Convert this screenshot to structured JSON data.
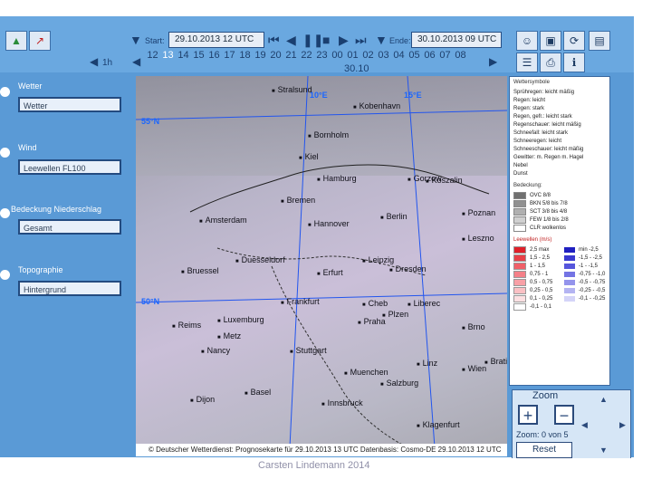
{
  "toolbar": {
    "start_label": "Start:",
    "start_value": "29.10.2013 12 UTC",
    "end_label": "Ende:",
    "end_value": "30.10.2013 09 UTC",
    "step_value": "1h",
    "hours": [
      "12",
      "13",
      "14",
      "15",
      "16",
      "17",
      "18",
      "19",
      "20",
      "21",
      "22",
      "23",
      "00",
      "01",
      "02",
      "03",
      "04",
      "05",
      "06",
      "07",
      "08"
    ],
    "selected_hour": "13",
    "date_below": "30.10"
  },
  "sidebar": {
    "sections": [
      {
        "title": "Wetter",
        "value": "Wetter"
      },
      {
        "title": "Wind",
        "value": "Leewellen FL100"
      },
      {
        "title": "Bedeckung  Niederschlag",
        "value": "Gesamt"
      },
      {
        "title": "Topographie",
        "value": "Hintergrund"
      }
    ]
  },
  "map": {
    "grid_labels": [
      "10°E",
      "15°E",
      "55°N",
      "50°N"
    ],
    "cities": [
      "Stralsund",
      "Kobenhavn",
      "Bornholm",
      "Kiel",
      "Hamburg",
      "Koszalin",
      "Bremen",
      "Gorzow",
      "Amsterdam",
      "Hannover",
      "Berlin",
      "Poznan",
      "Leszno",
      "Duesseldorf",
      "Leipzig",
      "Dresden",
      "Bruessel",
      "Erfurt",
      "Frankfurt",
      "Cheb",
      "Liberec",
      "Luxemburg",
      "Praha",
      "Plzen",
      "Brno",
      "Reims",
      "Metz",
      "Nancy",
      "Stuttgart",
      "Muenchen",
      "Salzburg",
      "Linz",
      "Wien",
      "Bratis",
      "Basel",
      "Dijon",
      "Innsbruck",
      "Klagenfurt"
    ],
    "footer": "© Deutscher Wetterdienst: Prognosekarte für 29.10.2013 13 UTC Datenbasis: Cosmo-DE 29.10.2013 12 UTC"
  },
  "legend": {
    "weather_title": "Wettersymbole",
    "weather_rows": [
      "Sprühregen: leicht  mäßig",
      "Regen: leicht",
      "Regen: stark",
      "Regen, gefr.: leicht  stark",
      "Regenschauer: leicht  mäßig",
      "Schneefall: leicht  stark",
      "Schneeregen: leicht",
      "Schneeschauer: leicht  mäßig",
      "Gewitter: m. Regen  m. Hagel",
      "Nebel",
      "Dunst"
    ],
    "cover_title": "Bedeckung:",
    "cover_rows": [
      "OVC 8/8",
      "BKN 5/8 bis 7/8",
      "SCT 3/8 bis 4/8",
      "FEW 1/8 bis 2/8",
      "CLR wolkenlos"
    ],
    "lee_title": "Leewellen (m/s)",
    "lee_rows": [
      {
        "pos": "2,5  max",
        "neg": "min  -2,5",
        "pc": "#e0202a",
        "nc": "#2020c0"
      },
      {
        "pos": "1,5 - 2,5",
        "neg": "-1,5 - -2,5",
        "pc": "#e84048",
        "nc": "#3a3ad0"
      },
      {
        "pos": "1 - 1,5",
        "neg": "-1 - -1,5",
        "pc": "#f06068",
        "nc": "#5656dc"
      },
      {
        "pos": "0,75 - 1",
        "neg": "-0,75 - -1,0",
        "pc": "#f48088",
        "nc": "#7474e4"
      },
      {
        "pos": "0,5 - 0,75",
        "neg": "-0,5 - -0,75",
        "pc": "#f8a0a6",
        "nc": "#9494ec"
      },
      {
        "pos": "0,25 - 0,5",
        "neg": "-0,25 - -0,5",
        "pc": "#fbc0c4",
        "nc": "#b4b4f2"
      },
      {
        "pos": "0,1 - 0,25",
        "neg": "-0,1 - -0,25",
        "pc": "#fde0e2",
        "nc": "#d4d4f8"
      },
      {
        "pos": "-0,1 - 0,1",
        "neg": "",
        "pc": "#ffffff",
        "nc": ""
      }
    ]
  },
  "zoom": {
    "title": "Zoom",
    "plus": "+",
    "minus": "−",
    "status": "Zoom: 0 von 5",
    "reset": "Reset"
  },
  "credit": "Carsten Lindemann 2014"
}
